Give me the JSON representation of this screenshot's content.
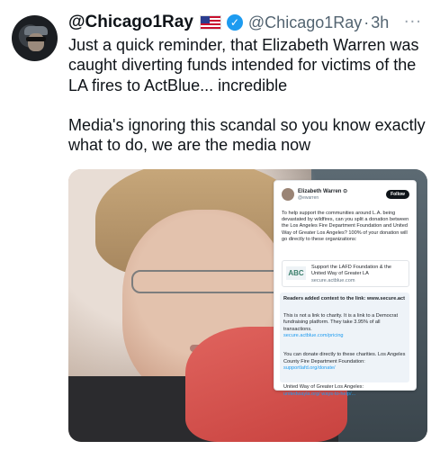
{
  "tweet": {
    "display_name": "@Chicago1Ray",
    "handle": "@Chicago1Ray",
    "separator": "·",
    "time": "3h",
    "more": "···",
    "verified_glyph": "✓",
    "text": "Just a quick reminder, that Elizabeth Warren was caught diverting funds intended for victims of the LA fires to ActBlue... incredible\n\nMedia's ignoring this scandal so you know exactly what to do, we are the media now"
  },
  "icons": {
    "avatar": "avatar-icon",
    "flag": "us-flag-icon",
    "verified": "verified-badge-icon",
    "more": "more-options-icon"
  },
  "colors": {
    "verified_blue": "#1d9bf0",
    "handle_gray": "#536471",
    "text": "#0f1419"
  },
  "embedded_screenshot": {
    "author_name": "Elizabeth Warren ⊙",
    "author_handle": "@ewarren",
    "follow_label": "Follow",
    "body": "To help support the communities around L.A. being devastated by wildfires, can you split a donation between the Los Angeles Fire Department Foundation and United Way of Greater Los Angeles? 100% of your donation will go directly to these organizations:",
    "link_logo": "ABC",
    "link_title": "Support the LAFD Foundation & the United Way of Greater LA",
    "link_url": "secure.actblue.com",
    "note_header": "Readers added context to the link: www.secure.act",
    "note_line1": "This is not a link to charity. It is a link to a Democrat fundraising platform. They take 3.95% of all transactions.",
    "note_link1": "secure.actblue.com/pricing",
    "note_line2": "You can donate directly to these charities. Los Angeles County Fire Department Foundation:",
    "note_link2": "supportlafd.org/donate/",
    "note_line3": "United Way of Greater Los Angeles:",
    "note_link3": "unitedwayla.org/ ways-to-help/..."
  }
}
